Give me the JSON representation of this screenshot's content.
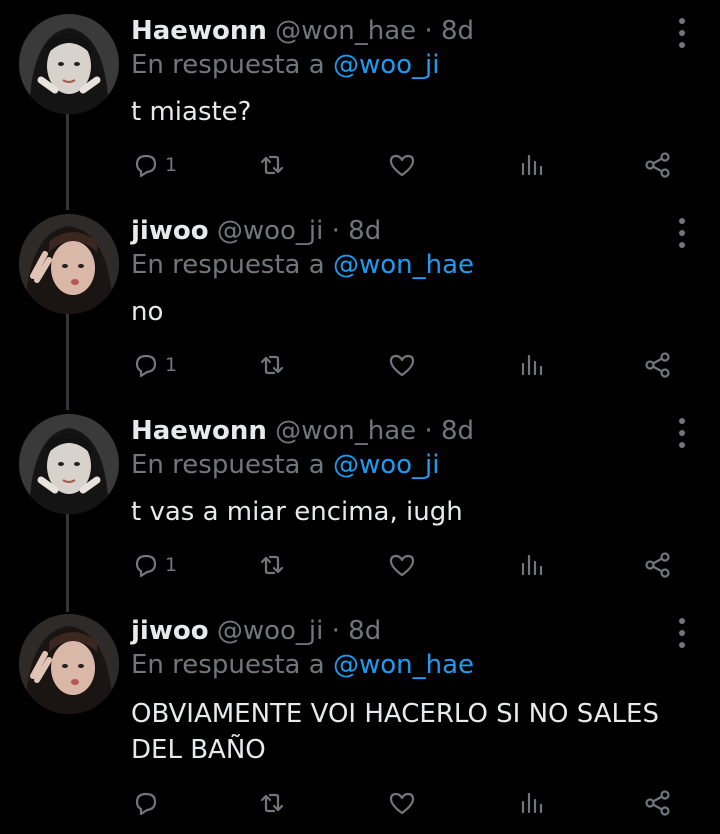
{
  "tweets": [
    {
      "name": "Haewonn",
      "handle": "@won_hae",
      "dot": "·",
      "time": "8d",
      "reply_prefix": "En respuesta a",
      "reply_mention": "@woo_ji",
      "text": "t miaste?",
      "reply_count": "1",
      "avatar": "avatar-haewonn"
    },
    {
      "name": "jiwoo",
      "handle": "@woo_ji",
      "dot": "·",
      "time": "8d",
      "reply_prefix": "En respuesta a",
      "reply_mention": "@won_hae",
      "text": "no",
      "reply_count": "1",
      "avatar": "avatar-jiwoo"
    },
    {
      "name": "Haewonn",
      "handle": "@won_hae",
      "dot": "·",
      "time": "8d",
      "reply_prefix": "En respuesta a",
      "reply_mention": "@woo_ji",
      "text": "t vas a miar encima, iugh",
      "reply_count": "1",
      "avatar": "avatar-haewonn"
    },
    {
      "name": "jiwoo",
      "handle": "@woo_ji",
      "dot": "·",
      "time": "8d",
      "reply_prefix": "En respuesta a",
      "reply_mention": "@won_hae",
      "text": "OBVIAMENTE VOI HACERLO SI NO SALES DEL BAÑO",
      "reply_count": "",
      "avatar": "avatar-jiwoo"
    }
  ],
  "icons": {
    "reply": "reply-icon",
    "retweet": "retweet-icon",
    "like": "heart-icon",
    "views": "views-icon",
    "share": "share-icon",
    "more": "more-icon"
  },
  "colors": {
    "background": "#000000",
    "text": "#e7e9ea",
    "muted": "#71767b",
    "mention": "#1d9bf0"
  }
}
